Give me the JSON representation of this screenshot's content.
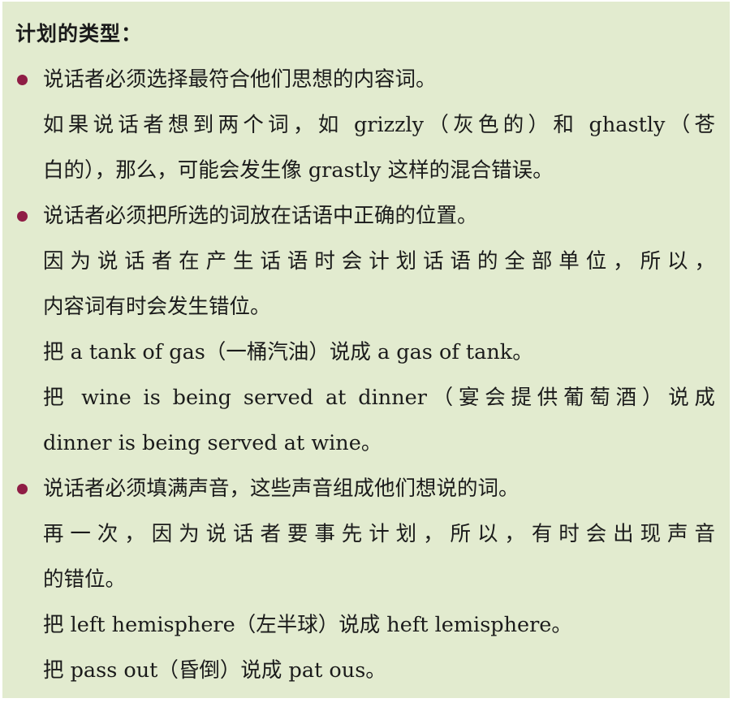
{
  "heading": "计划的类型：",
  "accent_color": "#8f1d45",
  "background_color": "#e2ebcf",
  "sections": [
    {
      "bullet_text": "说话者必须选择最符合他们思想的内容词。",
      "lines": [
        "如果说话者想到两个词，如 grizzly（灰色的）和 ghastly（苍",
        "白的），那么，可能会发生像 grastly 这样的混合错误。"
      ]
    },
    {
      "bullet_text": " 说话者必须把所选的词放在话语中正确的位置。",
      "lines": [
        "因为说话者在产生话语时会计划话语的全部单位，所以，",
        "内容词有时会发生错位。",
        "把 a tank of gas（一桶汽油）说成 a gas of tank。",
        "把 wine is being served at dinner（宴会提供葡萄酒）说成",
        "dinner is being served at wine。"
      ]
    },
    {
      "bullet_text": "说话者必须填满声音，这些声音组成他们想说的词。",
      "lines": [
        "再一次，因为说话者要事先计划，所以，有时会出现声音",
        "的错位。",
        "把 left hemisphere（左半球）说成 heft lemisphere。",
        "把 pass out（昏倒）说成 pat ous。"
      ]
    }
  ]
}
